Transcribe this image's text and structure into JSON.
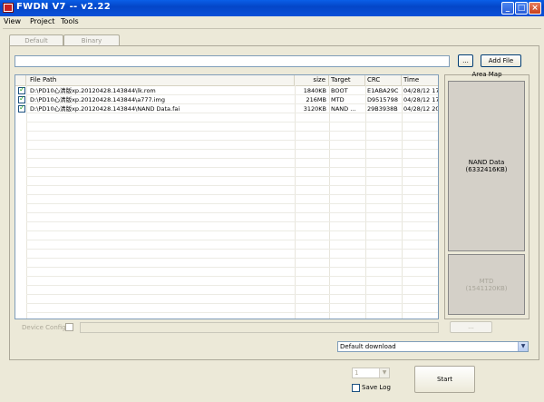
{
  "window": {
    "title": "FWDN V7 -- v2.22"
  },
  "menu": [
    {
      "label": "View"
    },
    {
      "label": "Project"
    },
    {
      "label": "Tools"
    }
  ],
  "tabs": [
    {
      "label": "Default"
    },
    {
      "label": "Binary"
    }
  ],
  "path_field": {
    "value": ""
  },
  "browse_button": {
    "label": "..."
  },
  "add_file_button": {
    "label": "Add File"
  },
  "file_list": {
    "columns": [
      "File Path",
      "size",
      "Target",
      "CRC",
      "Time"
    ],
    "rows": [
      {
        "checked": true,
        "path": "D:\\PD10心清版xp.20120428.143844\\lk.rom",
        "size": "1840KB",
        "target": "BOOT",
        "crc": "E1ABA29C",
        "time": "04/28/12 17:34"
      },
      {
        "checked": true,
        "path": "D:\\PD10心清版xp.20120428.143844\\a777.img",
        "size": "216MB",
        "target": "MTD",
        "crc": "D9515798",
        "time": "04/28/12 17:34"
      },
      {
        "checked": true,
        "path": "D:\\PD10心清版xp.20120428.143844\\NAND Data.fai",
        "size": "3120KB",
        "target": "NAND ...",
        "crc": "29B3938B",
        "time": "04/28/12 20:52"
      }
    ]
  },
  "area_map": {
    "title": "Area Map",
    "blocks": [
      {
        "label": "NAND Data",
        "detail": "(6332416KB)"
      },
      {
        "label": "MTD",
        "detail": "(1541120KB)"
      }
    ]
  },
  "device_config": {
    "label": "Device Config",
    "value": "",
    "button": "..."
  },
  "download_mode": {
    "selected": "Default download"
  },
  "port_select": {
    "value": "1"
  },
  "save_log": {
    "label": "Save Log",
    "checked": false
  },
  "start_button": {
    "label": "Start"
  }
}
